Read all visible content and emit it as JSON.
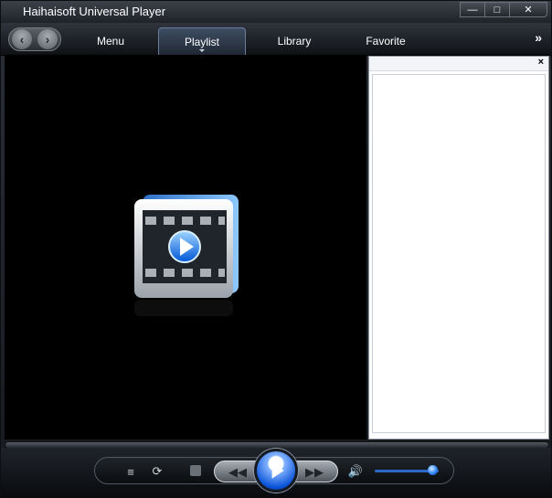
{
  "window": {
    "title": "Haihaisoft Universal Player",
    "minimize_label": "—",
    "maximize_label": "□",
    "close_label": "✕"
  },
  "navigation": {
    "back_label": "‹",
    "forward_label": "›",
    "tabs": [
      {
        "label": "Menu"
      },
      {
        "label": "Playlist"
      },
      {
        "label": "Library"
      },
      {
        "label": "Favorite"
      }
    ],
    "more_label": "»"
  },
  "playlist": {
    "close_label": "×",
    "items": []
  },
  "player": {
    "equalizer_label": "≡",
    "repeat_label": "⟳",
    "previous_label": "◀◀",
    "next_label": "▶▶",
    "volume_label": "🔊",
    "volume_level_percent": 88
  },
  "icons": {
    "media": "video-film-icon",
    "play": "play-icon",
    "stop": "stop-icon"
  },
  "colors": {
    "accent": "#0A53D8",
    "background": "#000000",
    "playlist_background": "#FFFFFF"
  }
}
